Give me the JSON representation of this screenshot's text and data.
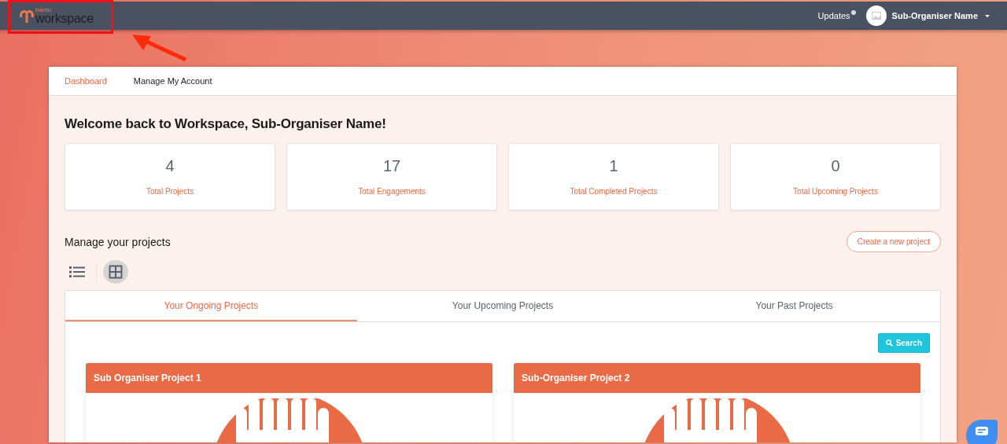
{
  "header": {
    "logo_small": "bantu",
    "logo": "workspace",
    "updates": "Updates",
    "updates_unread": true,
    "user": "Sub-Organiser Name"
  },
  "nav": [
    {
      "label": "Dashboard",
      "selected": true
    },
    {
      "label": "Manage My Account",
      "selected": false
    }
  ],
  "welcome": "Welcome back to Workspace, Sub-Organiser Name!",
  "stats": [
    {
      "value": "4",
      "label": "Total Projects"
    },
    {
      "value": "17",
      "label": "Total Engagements"
    },
    {
      "value": "1",
      "label": "Total Completed Projects"
    },
    {
      "value": "0",
      "label": "Total Upcoming Projects"
    }
  ],
  "manage_title": "Manage your projects",
  "create_button": "Create a new project",
  "views": [
    {
      "kind": "list",
      "selected": false
    },
    {
      "kind": "grid",
      "selected": true
    }
  ],
  "tabs": [
    {
      "label": "Your Ongoing Projects",
      "selected": true
    },
    {
      "label": "Your Upcoming Projects",
      "selected": false
    },
    {
      "label": "Your Past Projects",
      "selected": false
    }
  ],
  "search_button": "Search",
  "projects": [
    {
      "title": "Sub Organiser Project 1"
    },
    {
      "title": "Sub-Organiser Project 2"
    }
  ]
}
